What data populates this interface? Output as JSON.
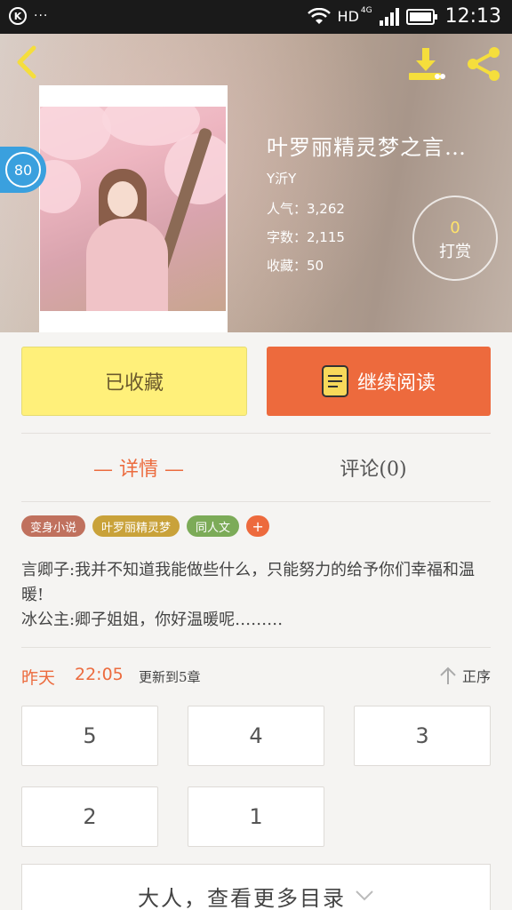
{
  "status_bar": {
    "dots": "···",
    "network_label": "HD",
    "network_type": "4G",
    "time": "12:13"
  },
  "book": {
    "title": "叶罗丽精灵梦之言…",
    "author": "Y沂Y",
    "popularity": "人气：3,262",
    "word_count": "字数：2,115",
    "favorites": "收藏：50",
    "score": "80"
  },
  "reward": {
    "count": "0",
    "label": "打赏"
  },
  "actions": {
    "collected_label": "已收藏",
    "continue_label": "继续阅读"
  },
  "tabs": [
    {
      "label": "— 详情 —",
      "active": true
    },
    {
      "label": "评论(0)",
      "active": false
    }
  ],
  "tags": [
    {
      "label": "变身小说",
      "color": "#c0715e"
    },
    {
      "label": "叶罗丽精灵梦",
      "color": "#c9a23a"
    },
    {
      "label": "同人文",
      "color": "#7cab58"
    }
  ],
  "tag_add_label": "+",
  "synopsis": {
    "line1": "言卿子:我并不知道我能做些什么，只能努力的给予你们幸福和温暖!",
    "line2": "冰公主:卿子姐姐，你好温暖呢………"
  },
  "update": {
    "day": "昨天",
    "time": "22:05",
    "note": "更新到5章",
    "sort_label": "正序"
  },
  "chapters": [
    "5",
    "4",
    "3",
    "2",
    "1"
  ],
  "more_catalog_label": "大人，查看更多目录",
  "colors": {
    "accent": "#ed6a3d",
    "collected": "#fff07a",
    "badge": "#3aa0de"
  }
}
